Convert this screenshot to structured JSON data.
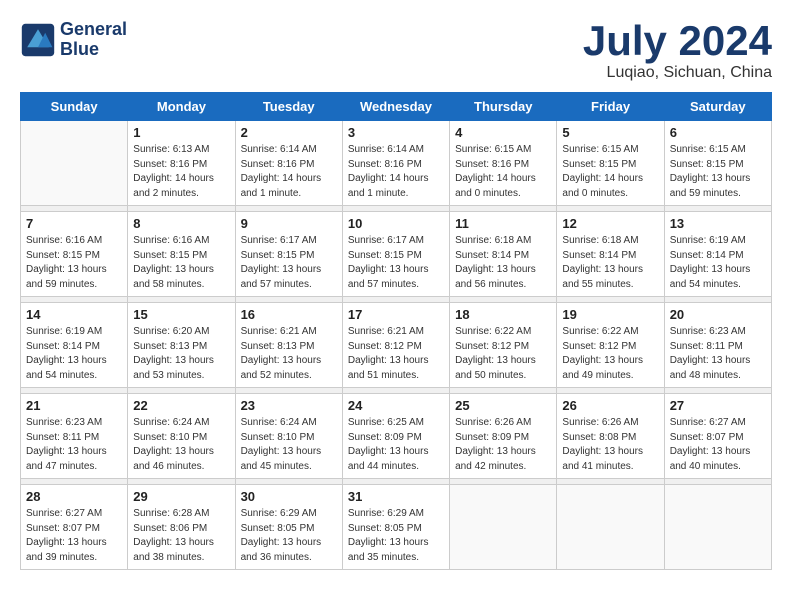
{
  "header": {
    "logo_line1": "General",
    "logo_line2": "Blue",
    "month": "July 2024",
    "location": "Luqiao, Sichuan, China"
  },
  "weekdays": [
    "Sunday",
    "Monday",
    "Tuesday",
    "Wednesday",
    "Thursday",
    "Friday",
    "Saturday"
  ],
  "weeks": [
    [
      {
        "day": "",
        "info": ""
      },
      {
        "day": "1",
        "info": "Sunrise: 6:13 AM\nSunset: 8:16 PM\nDaylight: 14 hours\nand 2 minutes."
      },
      {
        "day": "2",
        "info": "Sunrise: 6:14 AM\nSunset: 8:16 PM\nDaylight: 14 hours\nand 1 minute."
      },
      {
        "day": "3",
        "info": "Sunrise: 6:14 AM\nSunset: 8:16 PM\nDaylight: 14 hours\nand 1 minute."
      },
      {
        "day": "4",
        "info": "Sunrise: 6:15 AM\nSunset: 8:16 PM\nDaylight: 14 hours\nand 0 minutes."
      },
      {
        "day": "5",
        "info": "Sunrise: 6:15 AM\nSunset: 8:15 PM\nDaylight: 14 hours\nand 0 minutes."
      },
      {
        "day": "6",
        "info": "Sunrise: 6:15 AM\nSunset: 8:15 PM\nDaylight: 13 hours\nand 59 minutes."
      }
    ],
    [
      {
        "day": "7",
        "info": "Sunrise: 6:16 AM\nSunset: 8:15 PM\nDaylight: 13 hours\nand 59 minutes."
      },
      {
        "day": "8",
        "info": "Sunrise: 6:16 AM\nSunset: 8:15 PM\nDaylight: 13 hours\nand 58 minutes."
      },
      {
        "day": "9",
        "info": "Sunrise: 6:17 AM\nSunset: 8:15 PM\nDaylight: 13 hours\nand 57 minutes."
      },
      {
        "day": "10",
        "info": "Sunrise: 6:17 AM\nSunset: 8:15 PM\nDaylight: 13 hours\nand 57 minutes."
      },
      {
        "day": "11",
        "info": "Sunrise: 6:18 AM\nSunset: 8:14 PM\nDaylight: 13 hours\nand 56 minutes."
      },
      {
        "day": "12",
        "info": "Sunrise: 6:18 AM\nSunset: 8:14 PM\nDaylight: 13 hours\nand 55 minutes."
      },
      {
        "day": "13",
        "info": "Sunrise: 6:19 AM\nSunset: 8:14 PM\nDaylight: 13 hours\nand 54 minutes."
      }
    ],
    [
      {
        "day": "14",
        "info": "Sunrise: 6:19 AM\nSunset: 8:14 PM\nDaylight: 13 hours\nand 54 minutes."
      },
      {
        "day": "15",
        "info": "Sunrise: 6:20 AM\nSunset: 8:13 PM\nDaylight: 13 hours\nand 53 minutes."
      },
      {
        "day": "16",
        "info": "Sunrise: 6:21 AM\nSunset: 8:13 PM\nDaylight: 13 hours\nand 52 minutes."
      },
      {
        "day": "17",
        "info": "Sunrise: 6:21 AM\nSunset: 8:12 PM\nDaylight: 13 hours\nand 51 minutes."
      },
      {
        "day": "18",
        "info": "Sunrise: 6:22 AM\nSunset: 8:12 PM\nDaylight: 13 hours\nand 50 minutes."
      },
      {
        "day": "19",
        "info": "Sunrise: 6:22 AM\nSunset: 8:12 PM\nDaylight: 13 hours\nand 49 minutes."
      },
      {
        "day": "20",
        "info": "Sunrise: 6:23 AM\nSunset: 8:11 PM\nDaylight: 13 hours\nand 48 minutes."
      }
    ],
    [
      {
        "day": "21",
        "info": "Sunrise: 6:23 AM\nSunset: 8:11 PM\nDaylight: 13 hours\nand 47 minutes."
      },
      {
        "day": "22",
        "info": "Sunrise: 6:24 AM\nSunset: 8:10 PM\nDaylight: 13 hours\nand 46 minutes."
      },
      {
        "day": "23",
        "info": "Sunrise: 6:24 AM\nSunset: 8:10 PM\nDaylight: 13 hours\nand 45 minutes."
      },
      {
        "day": "24",
        "info": "Sunrise: 6:25 AM\nSunset: 8:09 PM\nDaylight: 13 hours\nand 44 minutes."
      },
      {
        "day": "25",
        "info": "Sunrise: 6:26 AM\nSunset: 8:09 PM\nDaylight: 13 hours\nand 42 minutes."
      },
      {
        "day": "26",
        "info": "Sunrise: 6:26 AM\nSunset: 8:08 PM\nDaylight: 13 hours\nand 41 minutes."
      },
      {
        "day": "27",
        "info": "Sunrise: 6:27 AM\nSunset: 8:07 PM\nDaylight: 13 hours\nand 40 minutes."
      }
    ],
    [
      {
        "day": "28",
        "info": "Sunrise: 6:27 AM\nSunset: 8:07 PM\nDaylight: 13 hours\nand 39 minutes."
      },
      {
        "day": "29",
        "info": "Sunrise: 6:28 AM\nSunset: 8:06 PM\nDaylight: 13 hours\nand 38 minutes."
      },
      {
        "day": "30",
        "info": "Sunrise: 6:29 AM\nSunset: 8:05 PM\nDaylight: 13 hours\nand 36 minutes."
      },
      {
        "day": "31",
        "info": "Sunrise: 6:29 AM\nSunset: 8:05 PM\nDaylight: 13 hours\nand 35 minutes."
      },
      {
        "day": "",
        "info": ""
      },
      {
        "day": "",
        "info": ""
      },
      {
        "day": "",
        "info": ""
      }
    ]
  ]
}
